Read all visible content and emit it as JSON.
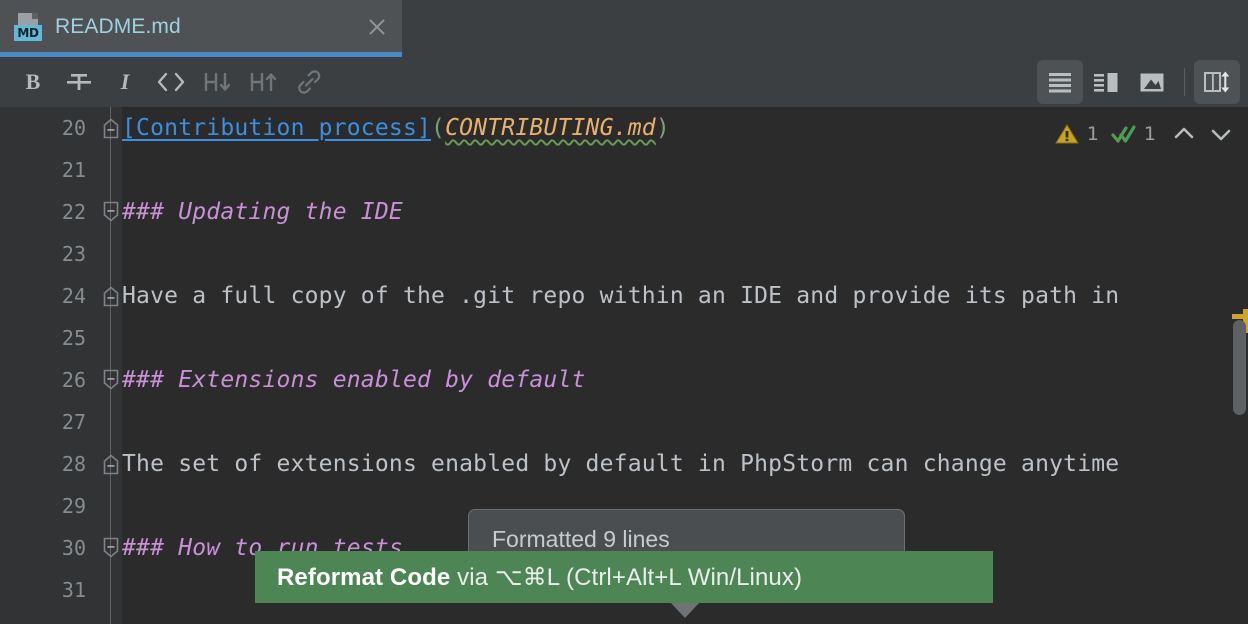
{
  "window": {
    "tab": {
      "title": "README.md",
      "file_type_badge": "MD",
      "close_label": "×"
    }
  },
  "toolbar": {
    "left_buttons": [
      {
        "name": "bold",
        "label": "B",
        "enabled": true
      },
      {
        "name": "strikethrough",
        "label": "S",
        "enabled": true
      },
      {
        "name": "italic",
        "label": "I",
        "enabled": true
      },
      {
        "name": "code",
        "label": "<>",
        "enabled": true
      },
      {
        "name": "heading-down",
        "label": "H↓",
        "enabled": false
      },
      {
        "name": "heading-up",
        "label": "H↑",
        "enabled": false
      },
      {
        "name": "link",
        "label": "🔗",
        "enabled": false
      }
    ],
    "right_buttons": [
      {
        "name": "editor-only-view",
        "label": "Editor only",
        "selected": true
      },
      {
        "name": "split-view",
        "label": "Editor and preview",
        "selected": false
      },
      {
        "name": "preview-only-view",
        "label": "Preview only",
        "selected": false
      },
      {
        "name": "sync-scroll",
        "label": "Sync scroll",
        "selected": true
      }
    ]
  },
  "inspections": {
    "warning_count": "1",
    "ok_count": "1",
    "prev_label": "Previous highlighted error",
    "next_label": "Next highlighted error"
  },
  "editor": {
    "lines": [
      {
        "number": "20",
        "fold": "end",
        "segments": [
          {
            "text": "[Contribution process]",
            "style": "link"
          },
          {
            "text": "(",
            "style": "paren"
          },
          {
            "text": "CONTRIBUTING.md",
            "style": "url"
          },
          {
            "text": ")",
            "style": "paren"
          }
        ]
      },
      {
        "number": "21",
        "fold": "none",
        "segments": []
      },
      {
        "number": "22",
        "fold": "start",
        "segments": [
          {
            "text": "### Updating the IDE",
            "style": "head"
          }
        ]
      },
      {
        "number": "23",
        "fold": "none",
        "segments": []
      },
      {
        "number": "24",
        "fold": "end",
        "segments": [
          {
            "text": "Have a full copy of the .git repo within an IDE and provide its path in",
            "style": "plain"
          }
        ]
      },
      {
        "number": "25",
        "fold": "none",
        "segments": []
      },
      {
        "number": "26",
        "fold": "start",
        "segments": [
          {
            "text": "### Extensions enabled by default",
            "style": "head"
          }
        ]
      },
      {
        "number": "27",
        "fold": "none",
        "segments": []
      },
      {
        "number": "28",
        "fold": "end",
        "segments": [
          {
            "text": "The set of extensions enabled by default in PhpStorm can change anytime",
            "style": "plain"
          }
        ]
      },
      {
        "number": "29",
        "fold": "none",
        "segments": []
      },
      {
        "number": "30",
        "fold": "start",
        "segments": [
          {
            "text": "### How to run tests",
            "style": "head"
          }
        ]
      },
      {
        "number": "31",
        "fold": "none",
        "segments": []
      }
    ]
  },
  "hint_popup": {
    "text": "Formatted 9 lines"
  },
  "callout": {
    "action": "Reformat Code",
    "rest": " via ⌥⌘L (Ctrl+Alt+L Win/Linux)"
  },
  "colors": {
    "accent_blue": "#4a88c7",
    "callout_green": "#4e8555",
    "warning_amber": "#d0a527",
    "ok_green": "#4e9a57",
    "heading_purple": "#c891d6",
    "link_blue": "#3a8fe0",
    "url_orange": "#e8b06b",
    "editor_bg": "#2b2b2b",
    "gutter_bg": "#313335",
    "chrome_bg": "#3c3f41"
  }
}
